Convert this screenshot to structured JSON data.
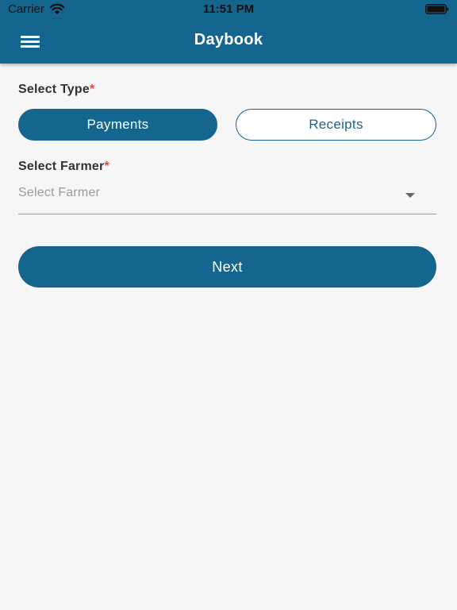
{
  "status_bar": {
    "carrier": "Carrier",
    "time": "11:51 PM"
  },
  "nav": {
    "title": "Daybook",
    "menu_icon": "hamburger-menu-icon"
  },
  "form": {
    "type_label": "Select Type",
    "type_required_mark": "*",
    "type_options": [
      {
        "label": "Payments",
        "selected": true
      },
      {
        "label": "Receipts",
        "selected": false
      }
    ],
    "farmer_label": "Select Farmer",
    "farmer_required_mark": "*",
    "farmer_placeholder": "Select Farmer",
    "farmer_value": ""
  },
  "actions": {
    "next_label": "Next"
  },
  "colors": {
    "primary": "#15668e",
    "required": "#e0453a",
    "background": "#f6f6f6"
  }
}
